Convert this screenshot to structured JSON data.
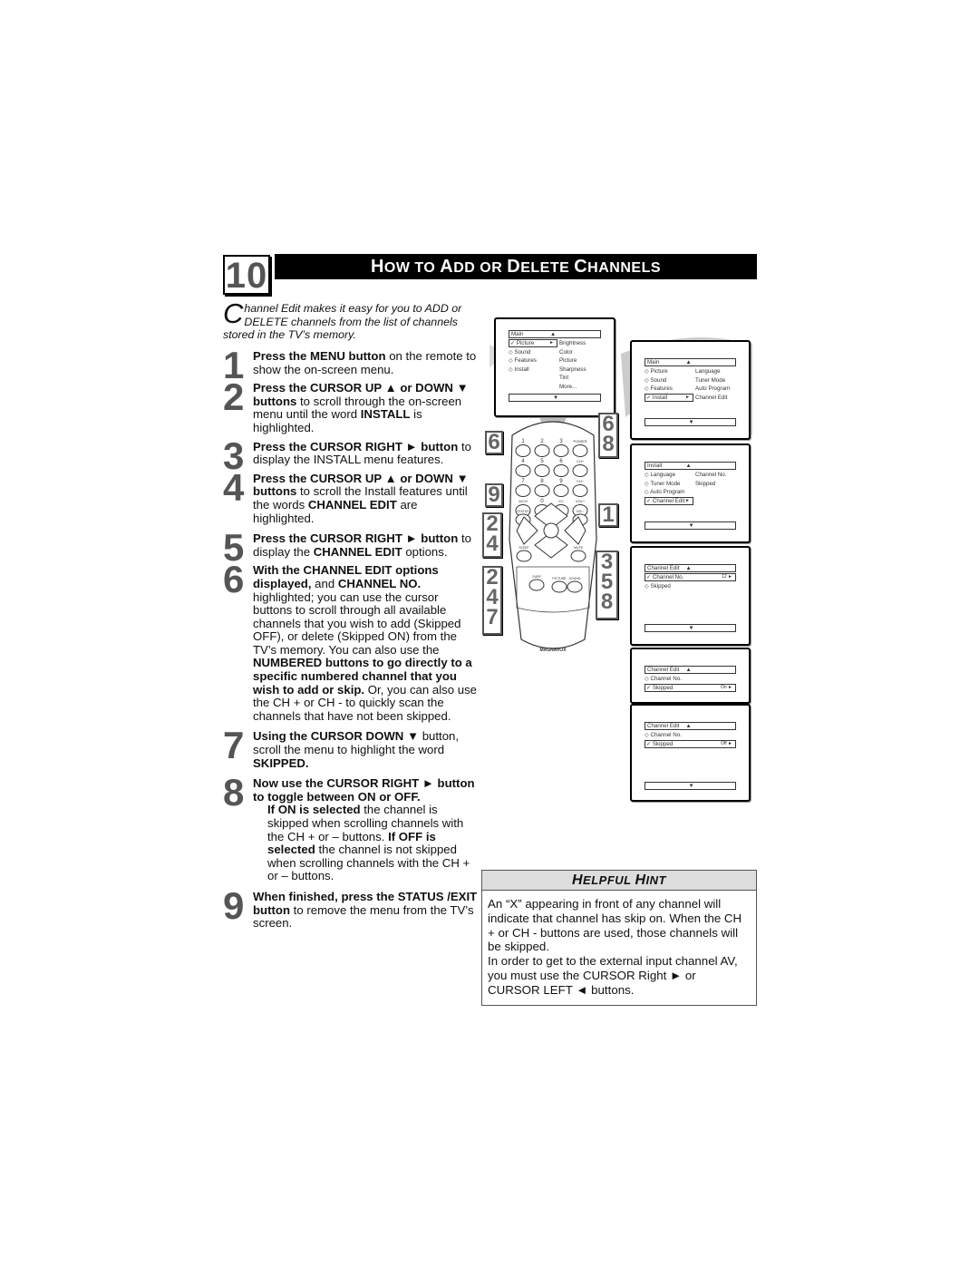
{
  "section": {
    "number": "10",
    "title_parts": [
      {
        "big": "H",
        "small": "OW TO "
      },
      {
        "big": "A",
        "small": "DD OR "
      },
      {
        "big": "D",
        "small": "ELETE "
      },
      {
        "big": "C",
        "small": "HANNELS"
      }
    ]
  },
  "intro": {
    "dropcap": "C",
    "text": "hannel Edit makes it easy for you to ADD or DELETE channels from the list of channels stored in the TV’s memory."
  },
  "steps": [
    {
      "num": "1",
      "html": "<b>Press the MENU button</b> on the remote to show the on-screen menu."
    },
    {
      "num": "2",
      "html": "<b>Press the CURSOR UP ▲ or DOWN ▼ buttons</b> to scroll through the on-screen menu until the word <b>INSTALL</b> is highlighted."
    },
    {
      "num": "3",
      "html": "<b>Press the CURSOR RIGHT ►</b> <b>button</b> to display the INSTALL menu features."
    },
    {
      "num": "4",
      "html": "<b>Press the CURSOR UP ▲ or DOWN ▼ buttons</b> to scroll the Install features until the words <b>CHANNEL EDIT</b> are highlighted."
    },
    {
      "num": "5",
      "html": "<b>Press the CURSOR RIGHT ►</b> <b>button</b> to display the <b>CHANNEL EDIT</b> options."
    },
    {
      "num": "6",
      "html": "<b>With the CHANNEL EDIT options displayed,</b> and <b>CHANNEL NO.</b> highlighted; you can use the cursor buttons  to scroll through all available channels that you wish to add (Skipped OFF), or delete (Skipped ON) from the TV’s memory.  You can also use the <b>NUMBERED buttons to go directly to a specific numbered channel that you wish to add or skip.</b> Or, you can also use the CH + or CH - to quickly scan the channels that have not been skipped."
    },
    {
      "num": "7",
      "html": "<b>Using the CURSOR DOWN ▼</b> button, scroll the menu to highlight the word <b>SKIPPED.</b>"
    },
    {
      "num": "8",
      "html": "<b>Now use the CURSOR RIGHT ► button to toggle between ON or OFF.</b><div class='sub'><b>If ON is selected</b> the channel is skipped when scrolling channels with the CH + or – buttons. <b>If OFF is selected</b> the channel is not skipped when scrolling channels with the CH + or – buttons.</div>"
    },
    {
      "num": "9",
      "html": "<b>When finished, press the STATUS /EXIT button</b> to remove the menu from the TV’s screen."
    }
  ],
  "screens": {
    "main_picture": {
      "header": "Main",
      "left": [
        "Picture",
        "Sound",
        "Features",
        "Install"
      ],
      "selected": 0,
      "right": [
        "Brightness",
        "Color",
        "Picture",
        "Sharpness",
        "Tint",
        "More..."
      ]
    },
    "main_install": {
      "header": "Main",
      "left": [
        "Picture",
        "Sound",
        "Features",
        "Install"
      ],
      "selected": 3,
      "right": [
        "Language",
        "Tuner Mode",
        "Auto Program",
        "Channel Edit"
      ]
    },
    "install": {
      "header": "Install",
      "left": [
        "Language",
        "Tuner Mode",
        "Auto Program",
        "Channel Edit"
      ],
      "selected": 3,
      "right": [
        "Channel No.",
        "Skipped"
      ]
    },
    "channel_edit_no": {
      "header": "Channel Edit",
      "left": [
        "Channel No.",
        "Skipped"
      ],
      "selected": 0,
      "value": "12"
    },
    "channel_edit_on": {
      "header": "Channel Edit",
      "left": [
        "Channel No.",
        "Skipped"
      ],
      "selected": 1,
      "value": "On"
    },
    "channel_edit_off": {
      "header": "Channel Edit",
      "left": [
        "Channel No.",
        "Skipped"
      ],
      "selected": 1,
      "value": "Off"
    }
  },
  "remote": {
    "brand": "MAGNAVOX",
    "buttons": [
      "1",
      "2",
      "3",
      "POWER",
      "4",
      "5",
      "6",
      "CH+",
      "7",
      "8",
      "9",
      "CH−",
      "A/CH",
      "0",
      "CC",
      "VOL+",
      "STATUS",
      "VOL−",
      "EXIT",
      "MENU",
      "SLEEP",
      "MUTE",
      "SURF",
      "SMART",
      "PICTURE",
      "SOUND"
    ],
    "callouts_left": [
      "6",
      "9",
      "2\n4",
      "2\n4\n7"
    ],
    "callouts_right": [
      "6\n8",
      "1",
      "3\n5\n8"
    ]
  },
  "hint": {
    "title_parts": [
      {
        "big": "H",
        "small": "ELPFUL "
      },
      {
        "big": "H",
        "small": "INT"
      }
    ],
    "paragraphs": [
      "An “X” appearing in front of any channel will indicate that channel has skip on. When the CH + or CH - buttons are used, those channels will be skipped.",
      "In order to get to the external input channel AV, you must use the CURSOR Right ► or CURSOR LEFT ◄ buttons."
    ]
  }
}
